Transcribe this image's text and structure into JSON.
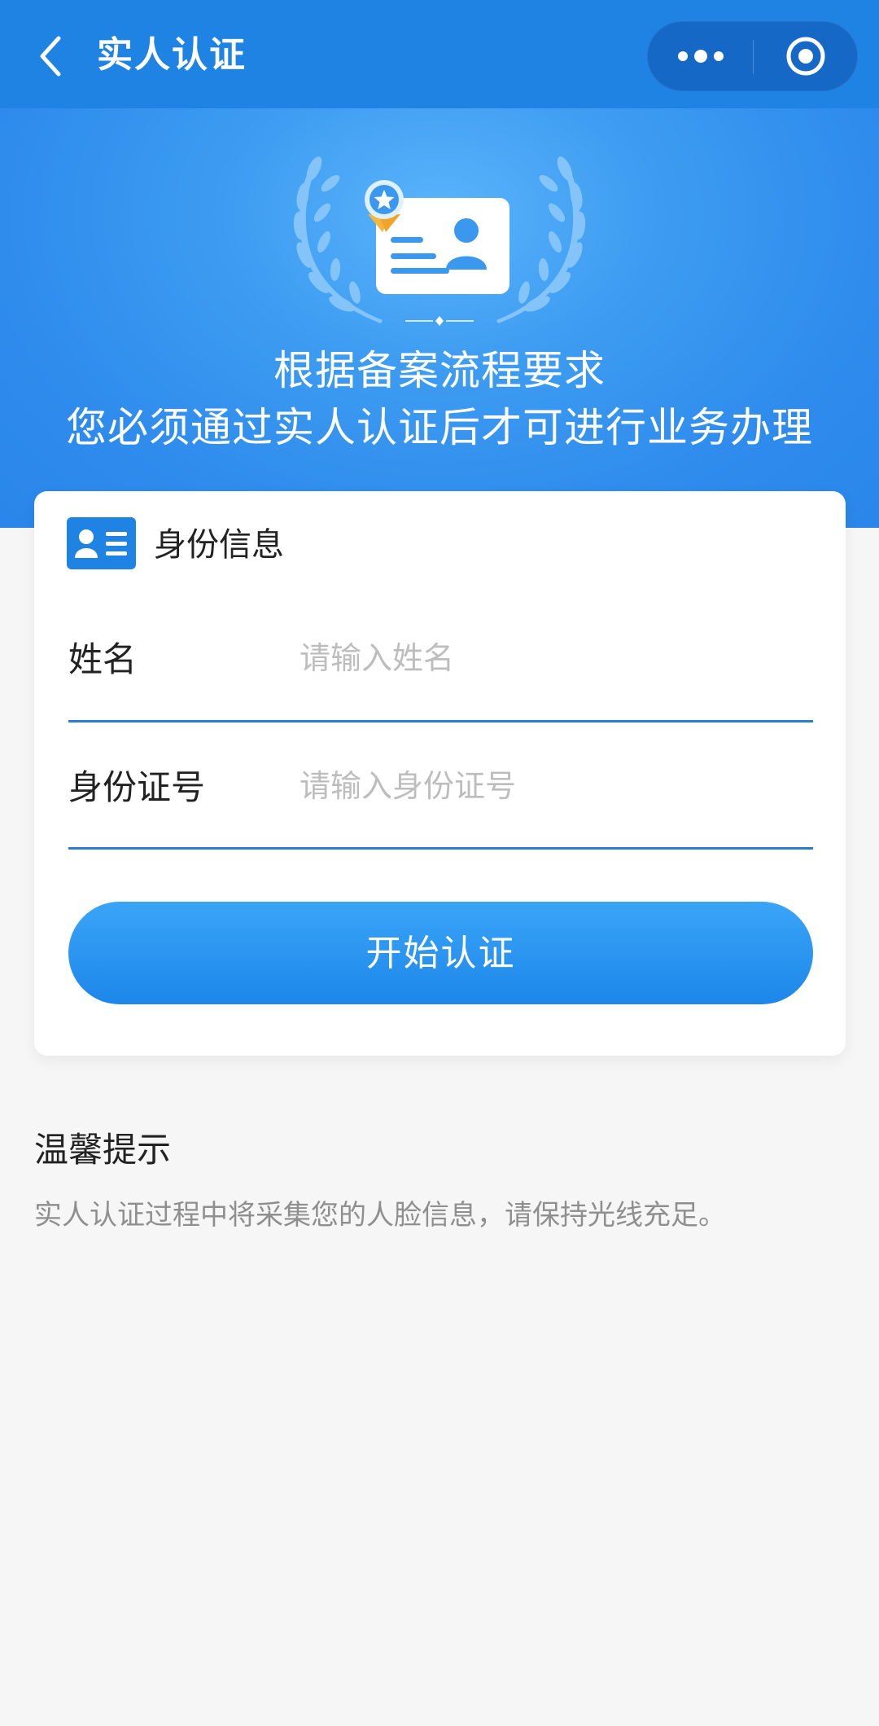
{
  "nav": {
    "title": "实人认证",
    "back_icon": "chevron-left-icon",
    "more_icon": "more-dots-icon",
    "close_icon": "target-circle-icon",
    "background_color": "#1e83e3"
  },
  "hero": {
    "line1": "根据备案流程要求",
    "line2": "您必须通过实人认证后才可进行业务办理",
    "illustration_icon": "id-card-badge-icon"
  },
  "card": {
    "header_title": "身份信息",
    "header_icon": "id-card-icon",
    "fields": [
      {
        "label": "姓名",
        "placeholder": "请输入姓名",
        "value": ""
      },
      {
        "label": "身份证号",
        "placeholder": "请输入身份证号",
        "value": ""
      }
    ],
    "submit_label": "开始认证",
    "accent_color": "#1e83e3"
  },
  "tips": {
    "title": "温馨提示",
    "text": "实人认证过程中将采集您的人脸信息，请保持光线充足。"
  }
}
